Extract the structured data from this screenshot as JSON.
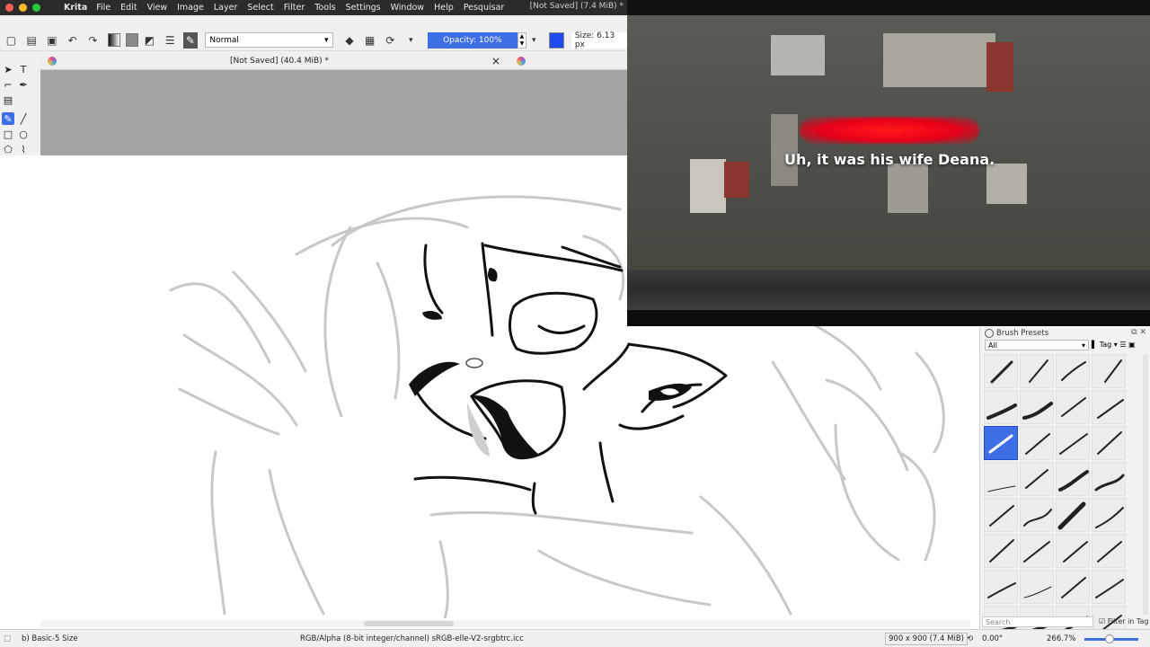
{
  "menubar": {
    "app_name": "Krita",
    "items": [
      "File",
      "Edit",
      "View",
      "Image",
      "Layer",
      "Select",
      "Filter",
      "Tools",
      "Settings",
      "Window",
      "Help",
      "Pesquisar"
    ],
    "window_title": "[Not Saved] (7.4 MiB) *",
    "light_colors": [
      "#fe5f57",
      "#febc2e",
      "#28c840"
    ]
  },
  "toolbar": {
    "blend_mode": "Normal",
    "opacity_label": "Opacity: 100%",
    "size_label": "Size: 6.13 px",
    "brush_color": "#1d4bf0",
    "accent": "#3d6ee6"
  },
  "document_tab": {
    "title": "[Not Saved]  (40.4 MiB) *",
    "close": "×"
  },
  "video": {
    "caption": "Uh, it was his wife Deana."
  },
  "brush_presets": {
    "title": "Brush Presets",
    "filter_value": "All",
    "tag_label": "Tag",
    "search_placeholder": "Search",
    "filter_in_tag_label": "Filter in Tag",
    "selected_index": 8
  },
  "statusbar": {
    "brush_name": "b) Basic-5 Size",
    "color_profile": "RGB/Alpha (8-bit integer/channel)  sRGB-elle-V2-srgbtrc.icc",
    "dimensions": "900 x 900 (7.4 MiB)",
    "rotation": "0.00°",
    "zoom": "266.7%"
  }
}
